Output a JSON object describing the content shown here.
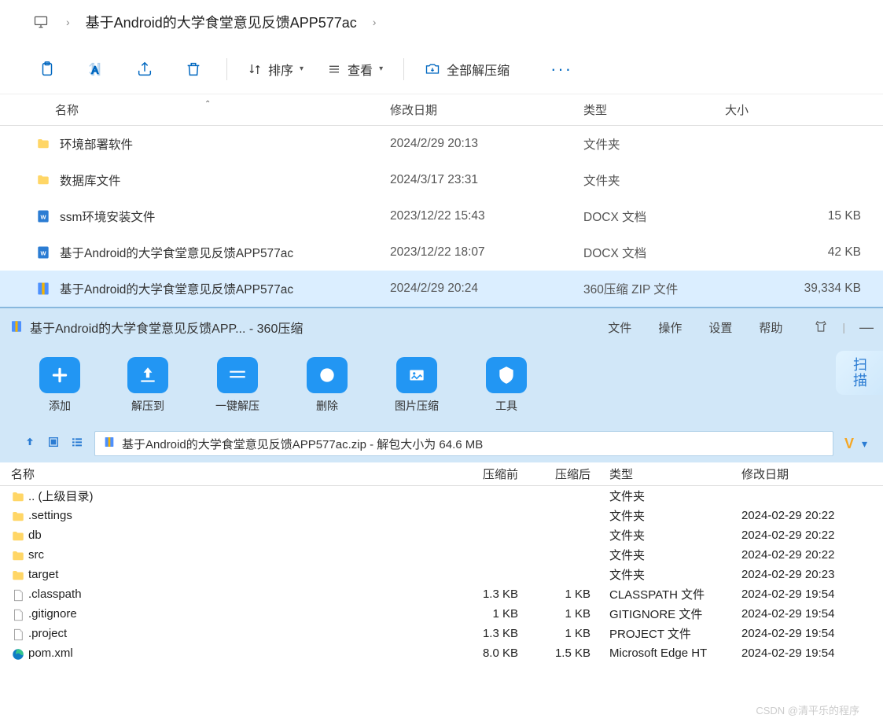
{
  "breadcrumb": {
    "path": "基于Android的大学食堂意见反馈APP577ac"
  },
  "toolbar": {
    "sort": "排序",
    "view": "查看",
    "extract_all": "全部解压缩"
  },
  "columns": {
    "name": "名称",
    "modified": "修改日期",
    "type": "类型",
    "size": "大小"
  },
  "files": [
    {
      "icon": "folder",
      "name": "环境部署软件",
      "modified": "2024/2/29 20:13",
      "type": "文件夹",
      "size": ""
    },
    {
      "icon": "folder",
      "name": "数据库文件",
      "modified": "2024/3/17 23:31",
      "type": "文件夹",
      "size": ""
    },
    {
      "icon": "docx",
      "name": "ssm环境安装文件",
      "modified": "2023/12/22 15:43",
      "type": "DOCX 文档",
      "size": "15 KB"
    },
    {
      "icon": "docx",
      "name": "基于Android的大学食堂意见反馈APP577ac",
      "modified": "2023/12/22 18:07",
      "type": "DOCX 文档",
      "size": "42 KB"
    },
    {
      "icon": "zip",
      "name": "基于Android的大学食堂意见反馈APP577ac",
      "modified": "2024/2/29 20:24",
      "type": "360压缩 ZIP 文件",
      "size": "39,334 KB",
      "selected": true
    }
  ],
  "archive": {
    "window_title": "基于Android的大学食堂意见反馈APP... - 360压缩",
    "menu": {
      "file": "文件",
      "action": "操作",
      "settings": "设置",
      "help": "帮助"
    },
    "buttons": {
      "add": "添加",
      "extract_to": "解压到",
      "extract_one": "一键解压",
      "delete": "删除",
      "img_compress": "图片压缩",
      "tools": "工具"
    },
    "scan": "扫描",
    "path_text": "基于Android的大学食堂意见反馈APP577ac.zip - 解包大小为 64.6 MB",
    "columns": {
      "name": "名称",
      "pre": "压缩前",
      "post": "压缩后",
      "type": "类型",
      "modified": "修改日期"
    },
    "rows": [
      {
        "icon": "folder",
        "name": ".. (上级目录)",
        "pre": "",
        "post": "",
        "type": "文件夹",
        "modified": ""
      },
      {
        "icon": "folder",
        "name": ".settings",
        "pre": "",
        "post": "",
        "type": "文件夹",
        "modified": "2024-02-29 20:22"
      },
      {
        "icon": "folder",
        "name": "db",
        "pre": "",
        "post": "",
        "type": "文件夹",
        "modified": "2024-02-29 20:22"
      },
      {
        "icon": "folder",
        "name": "src",
        "pre": "",
        "post": "",
        "type": "文件夹",
        "modified": "2024-02-29 20:22"
      },
      {
        "icon": "folder",
        "name": "target",
        "pre": "",
        "post": "",
        "type": "文件夹",
        "modified": "2024-02-29 20:23"
      },
      {
        "icon": "file",
        "name": ".classpath",
        "pre": "1.3 KB",
        "post": "1 KB",
        "type": "CLASSPATH 文件",
        "modified": "2024-02-29 19:54"
      },
      {
        "icon": "file",
        "name": ".gitignore",
        "pre": "1 KB",
        "post": "1 KB",
        "type": "GITIGNORE 文件",
        "modified": "2024-02-29 19:54"
      },
      {
        "icon": "file",
        "name": ".project",
        "pre": "1.3 KB",
        "post": "1 KB",
        "type": "PROJECT 文件",
        "modified": "2024-02-29 19:54"
      },
      {
        "icon": "edge",
        "name": "pom.xml",
        "pre": "8.0 KB",
        "post": "1.5 KB",
        "type": "Microsoft Edge HT",
        "modified": "2024-02-29 19:54"
      }
    ]
  },
  "watermark": "CSDN @清平乐的程序"
}
